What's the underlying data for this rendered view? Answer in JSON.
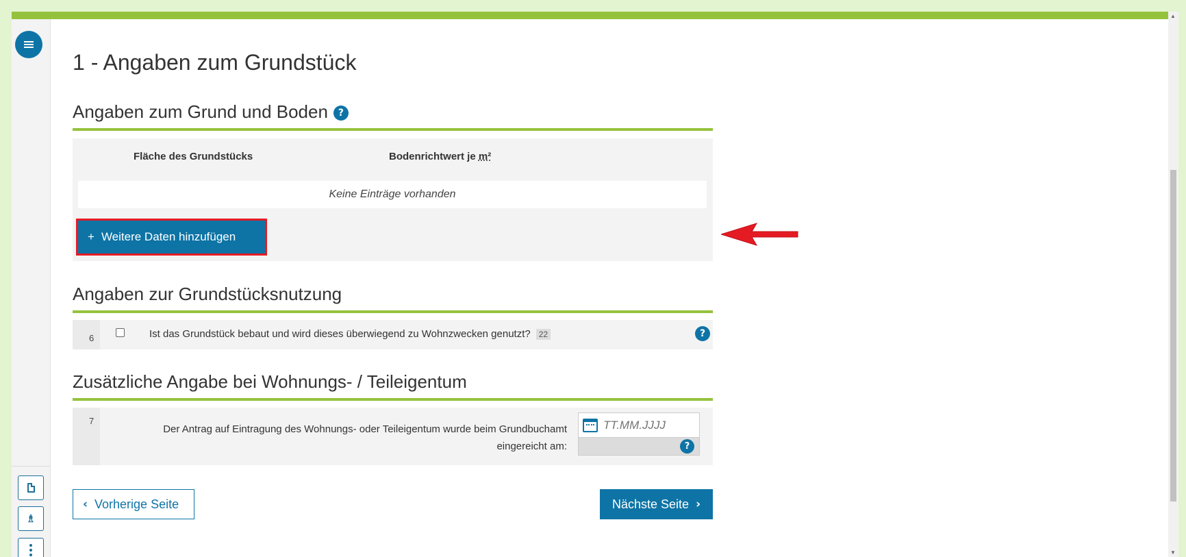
{
  "colors": {
    "accent_green": "#95c23d",
    "primary_blue": "#0e74a6",
    "highlight_red": "#e51b24"
  },
  "page": {
    "title": "1 - Angaben zum Grundstück"
  },
  "section_grund_boden": {
    "heading": "Angaben zum Grund und Boden",
    "help_icon": "question-circle-icon",
    "help_glyph": "?",
    "columns": [
      "Fläche des Grundstücks",
      "Bodenrichtwert je ",
      "m²"
    ],
    "empty_text": "Keine Einträge vorhanden",
    "add_button_label": "Weitere Daten hinzufügen",
    "add_button_icon": "+"
  },
  "section_nutzung": {
    "heading": "Angaben zur Grundstücksnutzung",
    "row": {
      "number": "6",
      "question": "Ist das Grundstück bebaut und wird dieses überwiegend zu Wohnzwecken genutzt?",
      "badge": "22",
      "checked": false
    }
  },
  "section_wohnungseigentum": {
    "heading": "Zusätzliche Angabe bei Wohnungs- / Teileigentum",
    "row": {
      "number": "7",
      "question": "Der Antrag auf Eintragung des Wohnungs- oder Teileigentum wurde beim Grundbuchamt eingereicht am:",
      "date_placeholder": "TT.MM.JJJJ",
      "date_value": ""
    }
  },
  "navigation": {
    "prev_label": "Vorherige Seite",
    "next_label": "Nächste Seite",
    "prev_icon": "‹",
    "next_icon": "›"
  },
  "sidebar": {
    "icons": [
      "menu-icon",
      "document-icon",
      "person-icon",
      "more-vertical-icon"
    ],
    "person_glyph": "♗"
  }
}
